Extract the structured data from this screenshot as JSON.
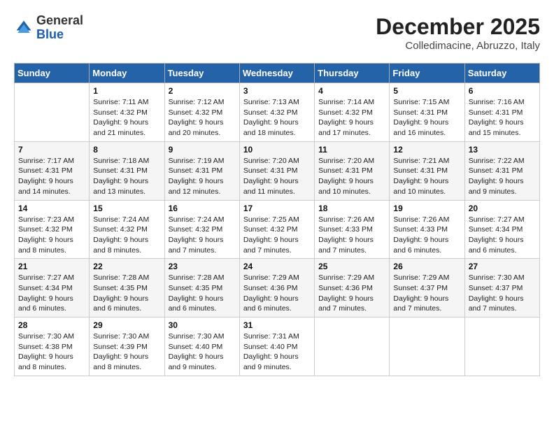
{
  "header": {
    "logo_general": "General",
    "logo_blue": "Blue",
    "month_title": "December 2025",
    "location": "Colledimacine, Abruzzo, Italy"
  },
  "days_of_week": [
    "Sunday",
    "Monday",
    "Tuesday",
    "Wednesday",
    "Thursday",
    "Friday",
    "Saturday"
  ],
  "weeks": [
    [
      {
        "day": "",
        "sunrise": "",
        "sunset": "",
        "daylight": ""
      },
      {
        "day": "1",
        "sunrise": "Sunrise: 7:11 AM",
        "sunset": "Sunset: 4:32 PM",
        "daylight": "Daylight: 9 hours and 21 minutes."
      },
      {
        "day": "2",
        "sunrise": "Sunrise: 7:12 AM",
        "sunset": "Sunset: 4:32 PM",
        "daylight": "Daylight: 9 hours and 20 minutes."
      },
      {
        "day": "3",
        "sunrise": "Sunrise: 7:13 AM",
        "sunset": "Sunset: 4:32 PM",
        "daylight": "Daylight: 9 hours and 18 minutes."
      },
      {
        "day": "4",
        "sunrise": "Sunrise: 7:14 AM",
        "sunset": "Sunset: 4:32 PM",
        "daylight": "Daylight: 9 hours and 17 minutes."
      },
      {
        "day": "5",
        "sunrise": "Sunrise: 7:15 AM",
        "sunset": "Sunset: 4:31 PM",
        "daylight": "Daylight: 9 hours and 16 minutes."
      },
      {
        "day": "6",
        "sunrise": "Sunrise: 7:16 AM",
        "sunset": "Sunset: 4:31 PM",
        "daylight": "Daylight: 9 hours and 15 minutes."
      }
    ],
    [
      {
        "day": "7",
        "sunrise": "Sunrise: 7:17 AM",
        "sunset": "Sunset: 4:31 PM",
        "daylight": "Daylight: 9 hours and 14 minutes."
      },
      {
        "day": "8",
        "sunrise": "Sunrise: 7:18 AM",
        "sunset": "Sunset: 4:31 PM",
        "daylight": "Daylight: 9 hours and 13 minutes."
      },
      {
        "day": "9",
        "sunrise": "Sunrise: 7:19 AM",
        "sunset": "Sunset: 4:31 PM",
        "daylight": "Daylight: 9 hours and 12 minutes."
      },
      {
        "day": "10",
        "sunrise": "Sunrise: 7:20 AM",
        "sunset": "Sunset: 4:31 PM",
        "daylight": "Daylight: 9 hours and 11 minutes."
      },
      {
        "day": "11",
        "sunrise": "Sunrise: 7:20 AM",
        "sunset": "Sunset: 4:31 PM",
        "daylight": "Daylight: 9 hours and 10 minutes."
      },
      {
        "day": "12",
        "sunrise": "Sunrise: 7:21 AM",
        "sunset": "Sunset: 4:31 PM",
        "daylight": "Daylight: 9 hours and 10 minutes."
      },
      {
        "day": "13",
        "sunrise": "Sunrise: 7:22 AM",
        "sunset": "Sunset: 4:31 PM",
        "daylight": "Daylight: 9 hours and 9 minutes."
      }
    ],
    [
      {
        "day": "14",
        "sunrise": "Sunrise: 7:23 AM",
        "sunset": "Sunset: 4:32 PM",
        "daylight": "Daylight: 9 hours and 8 minutes."
      },
      {
        "day": "15",
        "sunrise": "Sunrise: 7:24 AM",
        "sunset": "Sunset: 4:32 PM",
        "daylight": "Daylight: 9 hours and 8 minutes."
      },
      {
        "day": "16",
        "sunrise": "Sunrise: 7:24 AM",
        "sunset": "Sunset: 4:32 PM",
        "daylight": "Daylight: 9 hours and 7 minutes."
      },
      {
        "day": "17",
        "sunrise": "Sunrise: 7:25 AM",
        "sunset": "Sunset: 4:32 PM",
        "daylight": "Daylight: 9 hours and 7 minutes."
      },
      {
        "day": "18",
        "sunrise": "Sunrise: 7:26 AM",
        "sunset": "Sunset: 4:33 PM",
        "daylight": "Daylight: 9 hours and 7 minutes."
      },
      {
        "day": "19",
        "sunrise": "Sunrise: 7:26 AM",
        "sunset": "Sunset: 4:33 PM",
        "daylight": "Daylight: 9 hours and 6 minutes."
      },
      {
        "day": "20",
        "sunrise": "Sunrise: 7:27 AM",
        "sunset": "Sunset: 4:34 PM",
        "daylight": "Daylight: 9 hours and 6 minutes."
      }
    ],
    [
      {
        "day": "21",
        "sunrise": "Sunrise: 7:27 AM",
        "sunset": "Sunset: 4:34 PM",
        "daylight": "Daylight: 9 hours and 6 minutes."
      },
      {
        "day": "22",
        "sunrise": "Sunrise: 7:28 AM",
        "sunset": "Sunset: 4:35 PM",
        "daylight": "Daylight: 9 hours and 6 minutes."
      },
      {
        "day": "23",
        "sunrise": "Sunrise: 7:28 AM",
        "sunset": "Sunset: 4:35 PM",
        "daylight": "Daylight: 9 hours and 6 minutes."
      },
      {
        "day": "24",
        "sunrise": "Sunrise: 7:29 AM",
        "sunset": "Sunset: 4:36 PM",
        "daylight": "Daylight: 9 hours and 6 minutes."
      },
      {
        "day": "25",
        "sunrise": "Sunrise: 7:29 AM",
        "sunset": "Sunset: 4:36 PM",
        "daylight": "Daylight: 9 hours and 7 minutes."
      },
      {
        "day": "26",
        "sunrise": "Sunrise: 7:29 AM",
        "sunset": "Sunset: 4:37 PM",
        "daylight": "Daylight: 9 hours and 7 minutes."
      },
      {
        "day": "27",
        "sunrise": "Sunrise: 7:30 AM",
        "sunset": "Sunset: 4:37 PM",
        "daylight": "Daylight: 9 hours and 7 minutes."
      }
    ],
    [
      {
        "day": "28",
        "sunrise": "Sunrise: 7:30 AM",
        "sunset": "Sunset: 4:38 PM",
        "daylight": "Daylight: 9 hours and 8 minutes."
      },
      {
        "day": "29",
        "sunrise": "Sunrise: 7:30 AM",
        "sunset": "Sunset: 4:39 PM",
        "daylight": "Daylight: 9 hours and 8 minutes."
      },
      {
        "day": "30",
        "sunrise": "Sunrise: 7:30 AM",
        "sunset": "Sunset: 4:40 PM",
        "daylight": "Daylight: 9 hours and 9 minutes."
      },
      {
        "day": "31",
        "sunrise": "Sunrise: 7:31 AM",
        "sunset": "Sunset: 4:40 PM",
        "daylight": "Daylight: 9 hours and 9 minutes."
      },
      {
        "day": "",
        "sunrise": "",
        "sunset": "",
        "daylight": ""
      },
      {
        "day": "",
        "sunrise": "",
        "sunset": "",
        "daylight": ""
      },
      {
        "day": "",
        "sunrise": "",
        "sunset": "",
        "daylight": ""
      }
    ]
  ]
}
